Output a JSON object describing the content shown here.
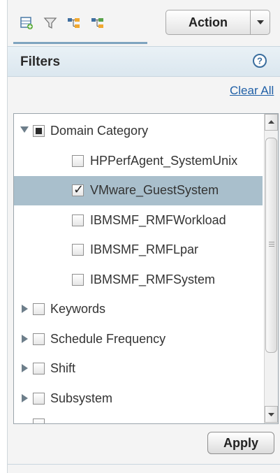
{
  "toolbar": {
    "icons": [
      "table-icon",
      "filter-icon",
      "tree-expand-icon",
      "tree-collapse-icon"
    ],
    "action_label": "Action"
  },
  "filters": {
    "title": "Filters",
    "clear_all_label": "Clear All",
    "apply_label": "Apply"
  },
  "tree": {
    "items": [
      {
        "label": "Domain Category",
        "level": 0,
        "expanded": true,
        "state": "partial"
      },
      {
        "label": "HPPerfAgent_SystemUnix",
        "level": 1,
        "state": "unchecked"
      },
      {
        "label": "VMware_GuestSystem",
        "level": 1,
        "state": "checked",
        "selected": true
      },
      {
        "label": "IBMSMF_RMFWorkload",
        "level": 1,
        "state": "unchecked"
      },
      {
        "label": "IBMSMF_RMFLpar",
        "level": 1,
        "state": "unchecked"
      },
      {
        "label": "IBMSMF_RMFSystem",
        "level": 1,
        "state": "unchecked"
      },
      {
        "label": "Keywords",
        "level": 0,
        "expanded": false,
        "state": "unchecked"
      },
      {
        "label": "Schedule Frequency",
        "level": 0,
        "expanded": false,
        "state": "unchecked"
      },
      {
        "label": "Shift",
        "level": 0,
        "expanded": false,
        "state": "unchecked"
      },
      {
        "label": "Subsystem",
        "level": 0,
        "expanded": false,
        "state": "unchecked"
      }
    ]
  },
  "colors": {
    "selected_row": "#a9bfcc",
    "link": "#1f5fa6",
    "header_bg": "#dbe7ef"
  }
}
